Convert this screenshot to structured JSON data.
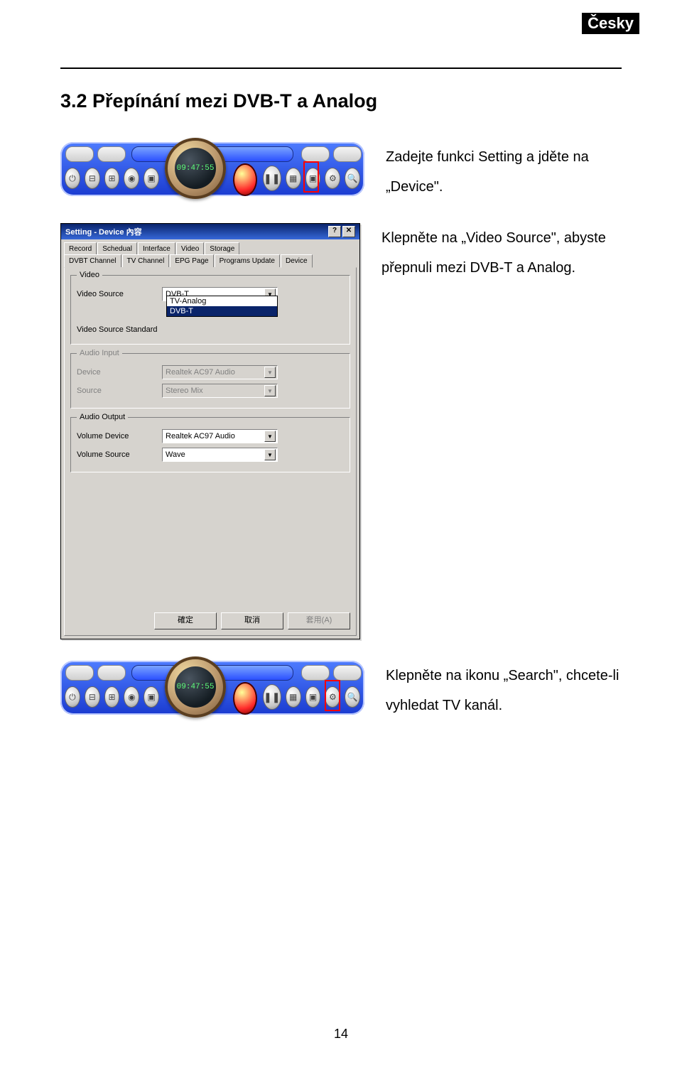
{
  "lang_badge": "Česky",
  "heading": "3.2 Přepínání mezi DVB-T a Analog",
  "text1_line1": "Zadejte funkci Setting a jděte na",
  "text1_line2": "„Device\".",
  "text2_line1": "Klepněte na „Video Source\", abyste",
  "text2_line2": "přepnuli mezi DVB-T a Analog.",
  "text3_line1": "Klepněte na ikonu „Search\", chcete-li",
  "text3_line2": "vyhledat TV kanál.",
  "page_number": "14",
  "player": {
    "time": "09:47:55"
  },
  "dialog": {
    "title": "Setting - Device 內容",
    "tabs_row1": [
      "Record",
      "Schedual",
      "Interface",
      "Video",
      "Storage"
    ],
    "tabs_row2": [
      "DVBT Channel",
      "TV Channel",
      "EPG Page",
      "Programs Update",
      "Device"
    ],
    "group_video": "Video",
    "label_video_source": "Video Source",
    "value_video_source": "DVB-T",
    "dd_opt1": "TV-Analog",
    "dd_opt2": "DVB-T",
    "label_vss": "Video Source Standard",
    "group_audio_input": "Audio Input",
    "label_device": "Device",
    "value_device": "Realtek AC97 Audio",
    "label_source_in": "Source",
    "value_source_in": "Stereo Mix",
    "group_audio_output": "Audio Output",
    "label_vol_device": "Volume Device",
    "value_vol_device": "Realtek AC97 Audio",
    "label_vol_source": "Volume Source",
    "value_vol_source": "Wave",
    "btn_ok": "確定",
    "btn_cancel": "取消",
    "btn_apply": "套用(A)"
  }
}
